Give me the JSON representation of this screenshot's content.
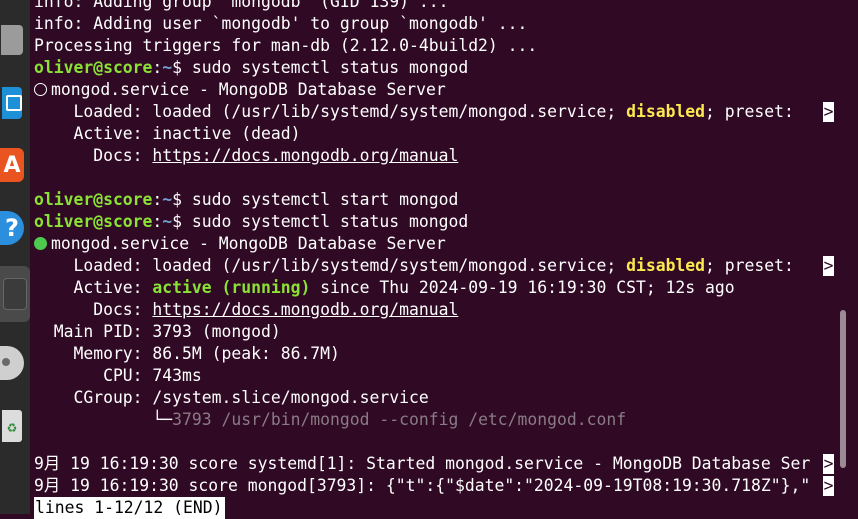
{
  "dock": {
    "items": [
      {
        "name": "files",
        "icon": "files-icon"
      },
      {
        "name": "writer",
        "icon": "writer-icon"
      },
      {
        "name": "app-center",
        "icon": "app-center-icon",
        "glyph": "A"
      },
      {
        "name": "help",
        "icon": "help-icon",
        "glyph": "?"
      },
      {
        "name": "terminal",
        "icon": "terminal-icon"
      },
      {
        "name": "dvd",
        "icon": "dvd-icon"
      },
      {
        "name": "trash",
        "icon": "trash-icon",
        "glyph": "♻"
      }
    ]
  },
  "colors": {
    "background": "#300a24",
    "prompt_user": "#8ae234",
    "prompt_path": "#729fcf",
    "highlight": "#fce94f",
    "active_dot": "#4ec94e"
  },
  "terminal": {
    "line0": "info: Adding group `mongodb' (GID 139) ...",
    "line1": "info: Adding user `mongodb' to group `mongodb' ...",
    "line2": "Processing triggers for man-db (2.12.0-4build2) ...",
    "prompt_user": "oliver@score",
    "prompt_sep": ":",
    "prompt_path": "~",
    "prompt_dollar": "$ ",
    "cmd1": "sudo systemctl status mongod",
    "svc_name": "mongod.service - MongoDB Database Server",
    "loaded_label": "    Loaded: ",
    "loaded_pre": "loaded (/usr/lib/systemd/system/mongod.service; ",
    "loaded_disabled": "disabled",
    "loaded_post": "; preset: ",
    "truncate_mark": ">",
    "active_label": "    Active: ",
    "inactive_value": "inactive (dead)",
    "docs_label": "      Docs: ",
    "docs_url": "https://docs.mongodb.org/manual",
    "cmd2": "sudo systemctl start mongod",
    "cmd3": "sudo systemctl status mongod",
    "active_running": "active (running)",
    "active_since": " since Thu 2024-09-19 16:19:30 CST; 12s ago",
    "mainpid_line": "  Main PID: 3793 (mongod)",
    "memory_line": "    Memory: 86.5M (peak: 86.7M)",
    "cpu_line": "       CPU: 743ms",
    "cgroup_line": "    CGroup: /system.slice/mongod.service",
    "tree_prefix": "            └─",
    "tree_proc": "3793 /usr/bin/mongod --config /etc/mongod.conf",
    "log1": "9月 19 16:19:30 score systemd[1]: Started mongod.service - MongoDB Database Ser",
    "log2": "9月 19 16:19:30 score mongod[3793]: {\"t\":{\"$date\":\"2024-09-19T08:19:30.718Z\"},\"",
    "pager_status": "lines 1-12/12 (END)"
  }
}
